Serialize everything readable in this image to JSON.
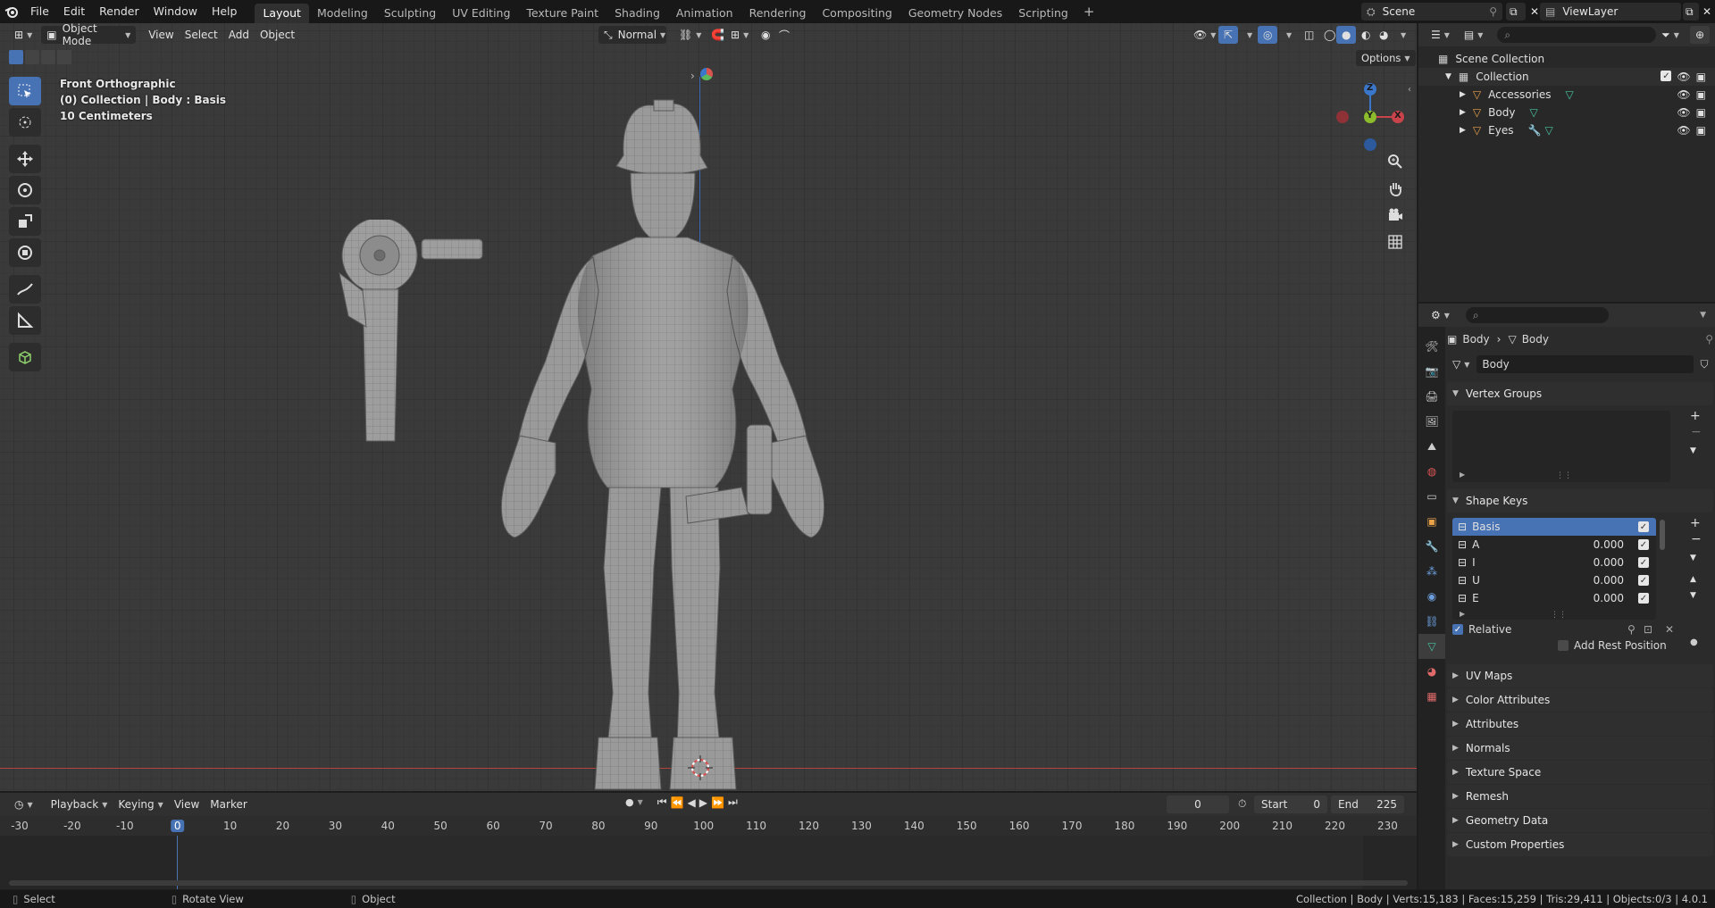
{
  "topbar": {
    "menus": [
      "File",
      "Edit",
      "Render",
      "Window",
      "Help"
    ],
    "workspaces": [
      "Layout",
      "Modeling",
      "Sculpting",
      "UV Editing",
      "Texture Paint",
      "Shading",
      "Animation",
      "Rendering",
      "Compositing",
      "Geometry Nodes",
      "Scripting"
    ],
    "active_workspace": "Layout",
    "scene": "Scene",
    "view_layer": "ViewLayer"
  },
  "viewport": {
    "mode": "Object Mode",
    "menus": [
      "View",
      "Select",
      "Add",
      "Object"
    ],
    "orientation": "Normal",
    "options": "Options",
    "overlay": {
      "view_name": "Front Orthographic",
      "collection_line": "(0) Collection | Body : Basis",
      "scale": "10 Centimeters"
    },
    "gizmo": {
      "x": "X",
      "y": "Y",
      "z": "Z"
    }
  },
  "outliner": {
    "root": "Scene Collection",
    "collection": "Collection",
    "items": [
      "Accessories",
      "Body",
      "Eyes"
    ]
  },
  "properties": {
    "breadcrumb_object": "Body",
    "breadcrumb_data": "Body",
    "data_name": "Body",
    "vertex_groups_title": "Vertex Groups",
    "shape_keys_title": "Shape Keys",
    "shape_keys": [
      {
        "name": "Basis",
        "value": ""
      },
      {
        "name": "A",
        "value": "0.000"
      },
      {
        "name": "I",
        "value": "0.000"
      },
      {
        "name": "U",
        "value": "0.000"
      },
      {
        "name": "E",
        "value": "0.000"
      }
    ],
    "relative_label": "Relative",
    "add_rest_label": "Add Rest Position",
    "panels": [
      "UV Maps",
      "Color Attributes",
      "Attributes",
      "Normals",
      "Texture Space",
      "Remesh",
      "Geometry Data",
      "Custom Properties"
    ]
  },
  "timeline": {
    "menus": [
      "Playback",
      "Keying",
      "View",
      "Marker"
    ],
    "current_frame": "0",
    "start_label": "Start",
    "start": "0",
    "end_label": "End",
    "end": "225",
    "ruler": [
      "-30",
      "-20",
      "-10",
      "0",
      "10",
      "20",
      "30",
      "40",
      "50",
      "60",
      "70",
      "80",
      "90",
      "100",
      "110",
      "120",
      "130",
      "140",
      "150",
      "160",
      "170",
      "180",
      "190",
      "200",
      "210",
      "220",
      "230"
    ]
  },
  "statusbar": {
    "left": [
      "Select",
      "Rotate View",
      "Object"
    ],
    "right": "Collection | Body | Verts:15,183 | Faces:15,259 | Tris:29,411 | Objects:0/3 | 4.0.1"
  },
  "colors": {
    "accent": "#4772b3",
    "x_axis": "#c9434a",
    "y_axis": "#8cbb2c",
    "z_axis": "#3a76c9"
  }
}
